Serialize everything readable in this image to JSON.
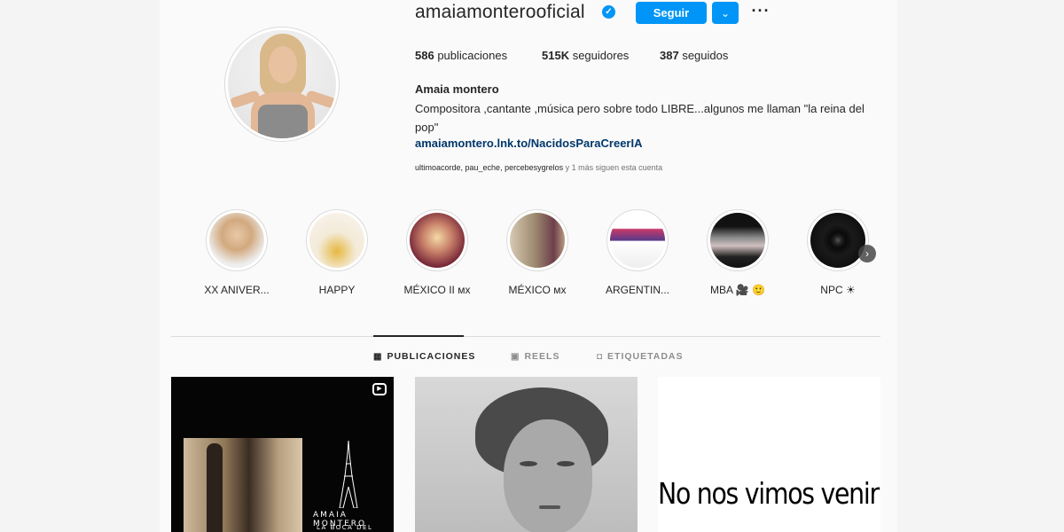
{
  "profile": {
    "username": "amaiamonterooficial",
    "verified_mark": "✓",
    "follow_label": "Seguir",
    "more_label": "⌄",
    "options_label": "···",
    "stats": [
      {
        "count": "586",
        "label": "publicaciones"
      },
      {
        "count": "515K",
        "label": "seguidores"
      },
      {
        "count": "387",
        "label": "seguidos"
      }
    ],
    "full_name": "Amaia montero",
    "bio": "Compositora ,cantante ,música pero sobre todo LIBRE...algunos me llaman \"la reina del pop\"",
    "link": "amaiamontero.lnk.to/NacidosParaCreerIA",
    "followed_by_names": "ultimoacorde, pau_eche, percebesygrelos",
    "followed_by_suffix": " y 1 más siguen esta cuenta"
  },
  "highlights": [
    {
      "label": "XX ANIVER..."
    },
    {
      "label": "HAPPY"
    },
    {
      "label": "MÉXICO II ᴍx"
    },
    {
      "label": "MÉXICO ᴍx"
    },
    {
      "label": "ARGENTIN..."
    },
    {
      "label": "MBA 🎥 🙂"
    },
    {
      "label": "NPC ☀"
    }
  ],
  "highlights_next_icon": "›",
  "tabs": [
    {
      "label": "PUBLICACIONES",
      "icon": "▦"
    },
    {
      "label": "REELS",
      "icon": "▣"
    },
    {
      "label": "ETIQUETADAS",
      "icon": "◘"
    }
  ],
  "posts": [
    {
      "title": "AMAIA MONTERO",
      "subtitle": "LA BOCA DEL LOBO",
      "reel_icon": "▶"
    },
    {},
    {
      "text": "No nos vimos venir"
    }
  ],
  "colors": {
    "accent": "#0095f6",
    "link": "#00376b"
  }
}
